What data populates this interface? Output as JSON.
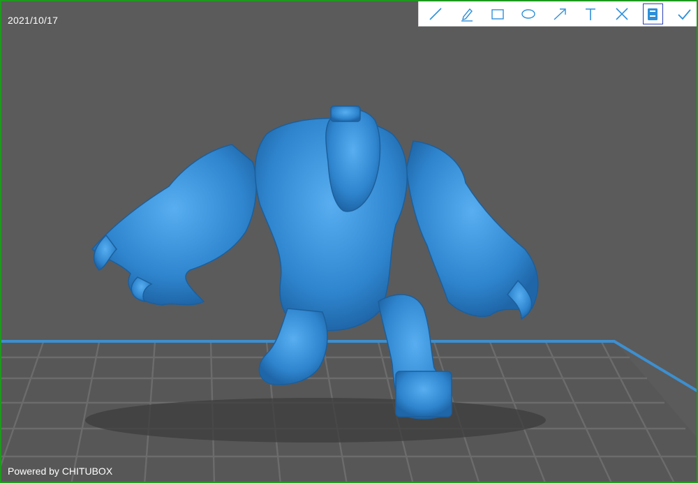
{
  "overlay": {
    "date": "2021/10/17",
    "powered_by": "Powered by CHITUBOX"
  },
  "toolbar": {
    "tools": [
      {
        "name": "line-tool",
        "icon": "line-icon"
      },
      {
        "name": "pencil-tool",
        "icon": "pencil-icon"
      },
      {
        "name": "rectangle-tool",
        "icon": "rectangle-icon"
      },
      {
        "name": "ellipse-tool",
        "icon": "ellipse-icon"
      },
      {
        "name": "arrow-tool",
        "icon": "arrow-icon"
      },
      {
        "name": "text-tool",
        "icon": "text-icon"
      },
      {
        "name": "cancel-tool",
        "icon": "close-icon"
      },
      {
        "name": "save-tool",
        "icon": "save-icon",
        "active": true
      },
      {
        "name": "confirm-tool",
        "icon": "check-icon"
      }
    ],
    "icon_color": "#2f8fd8",
    "active_outline_color": "#2b3fb3"
  },
  "viewport": {
    "background_color": "#5b5b5b",
    "border_color": "#1e9a1e",
    "grid_color": "#6c6c6c",
    "plate_edge_color": "#3d8fd0",
    "model_color": "#3a8fd4"
  }
}
